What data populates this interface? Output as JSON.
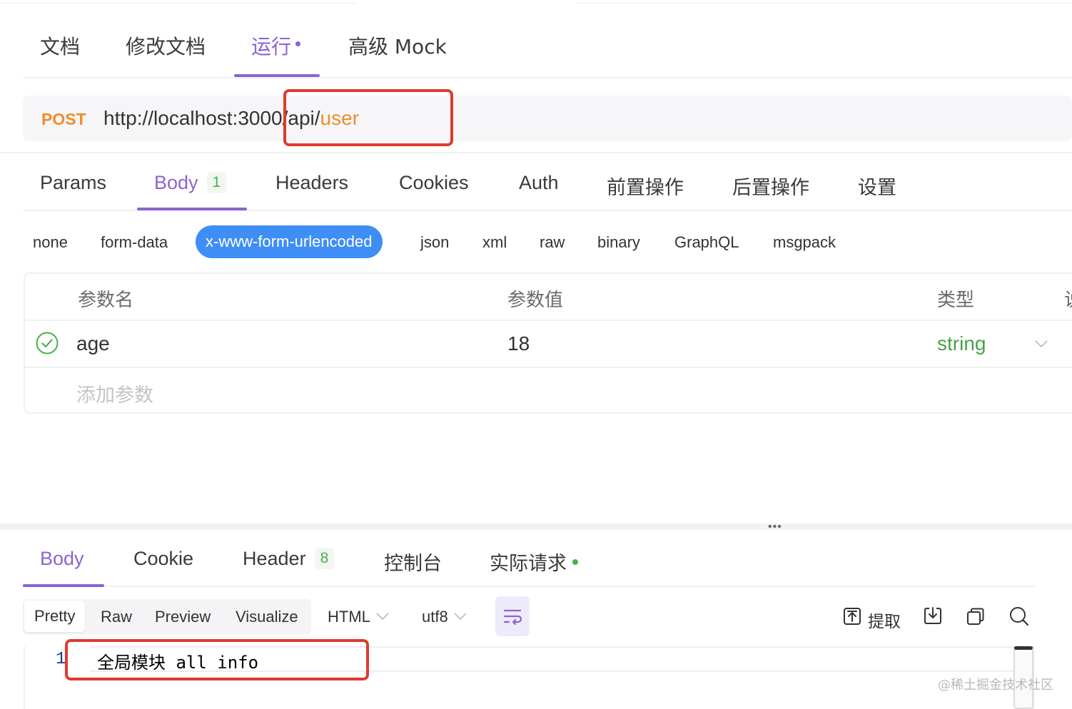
{
  "doc_tabs": [
    {
      "label": "文档"
    },
    {
      "label": "修改文档"
    },
    {
      "label": "运行"
    },
    {
      "label": "高级 Mock"
    }
  ],
  "request": {
    "method": "POST",
    "url_base": "http://localhost:3000/api/",
    "url_highlight": "user"
  },
  "request_tabs": [
    {
      "label": "Params"
    },
    {
      "label": "Body",
      "badge": "1"
    },
    {
      "label": "Headers"
    },
    {
      "label": "Cookies"
    },
    {
      "label": "Auth"
    },
    {
      "label": "前置操作"
    },
    {
      "label": "后置操作"
    },
    {
      "label": "设置"
    }
  ],
  "body_types": [
    "none",
    "form-data",
    "x-www-form-urlencoded",
    "json",
    "xml",
    "raw",
    "binary",
    "GraphQL",
    "msgpack"
  ],
  "params_table": {
    "headers": [
      "参数名",
      "参数值",
      "类型",
      "说"
    ],
    "rows": [
      {
        "name": "age",
        "value": "18",
        "type": "string",
        "checked": true
      }
    ],
    "add_placeholder": "添加参数"
  },
  "response_tabs": [
    {
      "label": "Body"
    },
    {
      "label": "Cookie"
    },
    {
      "label": "Header",
      "badge": "8"
    },
    {
      "label": "控制台"
    },
    {
      "label": "实际请求"
    }
  ],
  "response_toolbar": {
    "views": [
      "Pretty",
      "Raw",
      "Preview",
      "Visualize"
    ],
    "format": "HTML",
    "encoding": "utf8",
    "extract_label": "提取"
  },
  "response_body": {
    "line_number": "1",
    "content": "全局模块 all info"
  },
  "watermark": "@稀土掘金技术社区",
  "colors": {
    "accent_purple": "#8a63d2",
    "method_orange": "#f08c2e",
    "active_blue": "#3f8ef5",
    "success_green": "#4caf50",
    "annotation_red": "#e03a2e"
  }
}
